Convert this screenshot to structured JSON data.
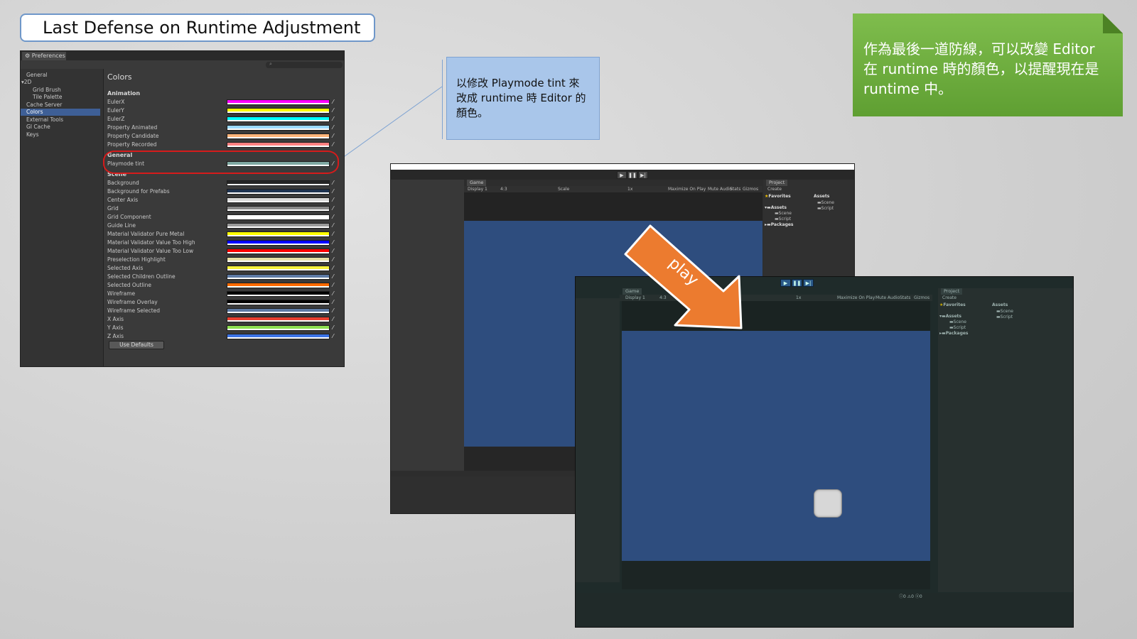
{
  "slide": {
    "title": "Last Defense on Runtime Adjustment",
    "green_note": "作為最後一道防線，可以改變 Editor 在 runtime 時的顏色，以提醒現在是 runtime 中。",
    "blue_callout": "以修改 Playmode tint 來改成 runtime 時 Editor 的顏色。",
    "arrow_label": "play"
  },
  "colors": {
    "green": "#6aab3a",
    "callout": "#a9c6ea",
    "arrow": "#ec7b2f",
    "highlight": "#d61b1b",
    "unity_selection": "#3e5f96",
    "game_view": "#2e4d7e"
  },
  "preferences": {
    "tab": "Preferences",
    "sidebar": [
      "General",
      "2D",
      "Grid Brush",
      "Tile Palette",
      "Cache Server",
      "Colors",
      "External Tools",
      "GI Cache",
      "Keys"
    ],
    "selected": "Colors",
    "heading": "Colors",
    "button": "Use Defaults",
    "sections": [
      {
        "name": "Animation",
        "items": [
          {
            "label": "EulerX",
            "color": "#ff00ff"
          },
          {
            "label": "EulerY",
            "color": "#ffff00"
          },
          {
            "label": "EulerZ",
            "color": "#00ffff"
          },
          {
            "label": "Property Animated",
            "color": "#9ad9ff"
          },
          {
            "label": "Property Candidate",
            "color": "#ffb47a"
          },
          {
            "label": "Property Recorded",
            "color": "#ff8080"
          }
        ]
      },
      {
        "name": "General",
        "items": [
          {
            "label": "Playmode tint",
            "color": "#7fa8a2"
          }
        ]
      },
      {
        "name": "Scene",
        "items": [
          {
            "label": "Background",
            "color": "#252525"
          },
          {
            "label": "Background for Prefabs",
            "color": "#1e3350"
          },
          {
            "label": "Center Axis",
            "color": "#d9d9d9"
          },
          {
            "label": "Grid",
            "color": "#8a8a8a"
          },
          {
            "label": "Grid Component",
            "color": "#ffffff"
          },
          {
            "label": "Guide Line",
            "color": "#9a9a9a"
          },
          {
            "label": "Material Validator Pure Metal",
            "color": "#ffff00"
          },
          {
            "label": "Material Validator Value Too High",
            "color": "#0000ff"
          },
          {
            "label": "Material Validator Value Too Low",
            "color": "#ff0000"
          },
          {
            "label": "Preselection Highlight",
            "color": "#e6e0a6"
          },
          {
            "label": "Selected Axis",
            "color": "#f5f23c"
          },
          {
            "label": "Selected Children Outline",
            "color": "#5e7ba6"
          },
          {
            "label": "Selected Outline",
            "color": "#ff6a00"
          },
          {
            "label": "Wireframe",
            "color": "#000000"
          },
          {
            "label": "Wireframe Overlay",
            "color": "#000000"
          },
          {
            "label": "Wireframe Selected",
            "color": "#5e7ba6"
          },
          {
            "label": "X Axis",
            "color": "#ea4030"
          },
          {
            "label": "Y Axis",
            "color": "#8de050"
          },
          {
            "label": "Z Axis",
            "color": "#3b73e6"
          }
        ]
      }
    ]
  },
  "editor_back": {
    "game_tab": "Game",
    "display": "Display 1",
    "aspect": "4:3",
    "scale_label": "Scale",
    "scale_value": "1x",
    "toolbar_right": [
      "Maximize On Play",
      "Mute Audio",
      "Stats",
      "Gizmos"
    ],
    "project_tab": "Project",
    "create": "Create",
    "favorites": "Favorites",
    "assets_header": "Assets",
    "tree": [
      "Assets",
      "Scene",
      "Script",
      "Packages"
    ],
    "assets": [
      "Scene",
      "Script"
    ]
  },
  "editor_front": {
    "game_tab": "Game",
    "display": "Display 1",
    "aspect": "4:3",
    "scale_value": "1x",
    "toolbar_right": [
      "Maximize On Play",
      "Mute Audio",
      "Stats",
      "Gizmos"
    ],
    "project_tab": "Project",
    "create": "Create",
    "favorites": "Favorites",
    "assets_header": "Assets",
    "tree": [
      "Assets",
      "Scene",
      "Script",
      "Packages"
    ],
    "assets": [
      "Scene",
      "Script"
    ],
    "status_counts": [
      "0",
      "0",
      "0"
    ]
  }
}
